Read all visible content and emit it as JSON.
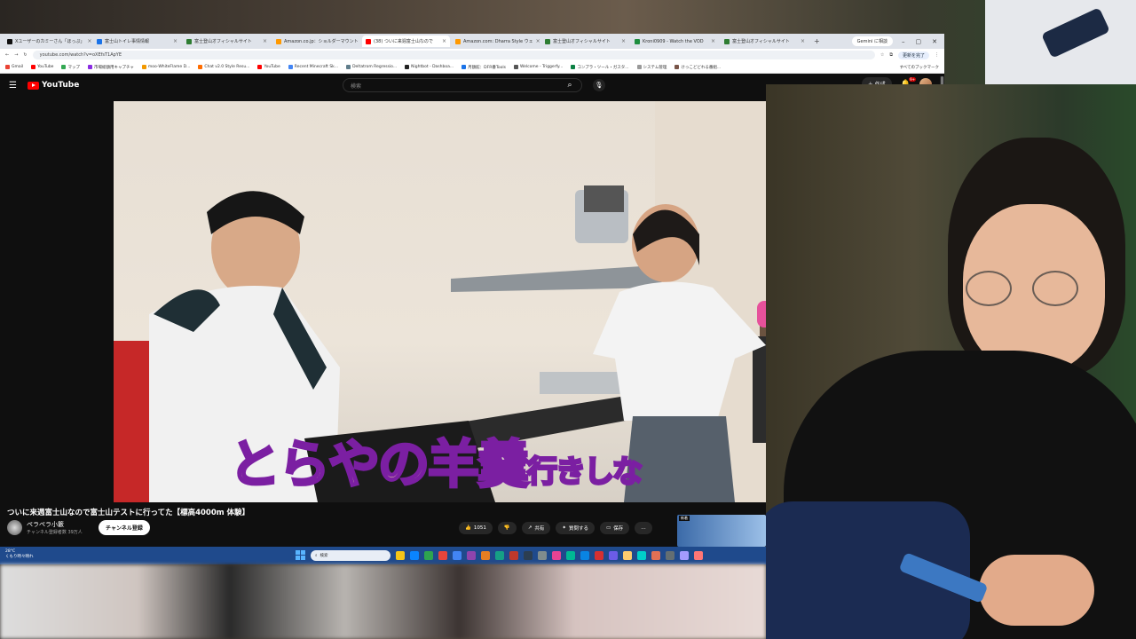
{
  "browser": {
    "tabs": [
      {
        "label": "Xユーザーのカミーさん「ほっぷ」",
        "color": "#111"
      },
      {
        "label": "富士山トイレ事情情報",
        "color": "#1a73e8"
      },
      {
        "label": "富士登山オフィシャルサイト",
        "color": "#2e7d32"
      },
      {
        "label": "Amazon.co.jp：ショルダーマウント",
        "color": "#ff9900"
      },
      {
        "label": "(38) ついに来週富士山なので",
        "color": "#ff0000",
        "active": true
      },
      {
        "label": "Amazon.com: Dharra Style ウェ",
        "color": "#ff9900"
      },
      {
        "label": "富士登山オフィシャルサイト",
        "color": "#2e7d32"
      },
      {
        "label": "Kroni0909 - Watch the VOD",
        "color": "#1e8e3e"
      },
      {
        "label": "富士登山オフィシャルサイト",
        "color": "#2e7d32"
      }
    ],
    "gemini_label": "Gemini に相談",
    "url": "youtube.com/watch?v=oXEfsT1ApYE",
    "update_label": "更新を完了",
    "bookmarks": [
      "Gmail",
      "YouTube",
      "マップ",
      "市場総額用キャプチャ",
      "moo-WhiteFlame D...",
      "Chat v2.0 Style Resu...",
      "YouTube",
      "Recent Minecraft Sk...",
      "Deltatrom Regressio...",
      "Nightbot - Dashboa...",
      "月額館：DFR番Tools",
      "Welcome - Triggerfy...",
      "コンプラ・ツール・ガスタ...",
      "システム管理",
      "けっこどどれる番組..."
    ],
    "bookmarks_right": "すべてのブックマーク"
  },
  "youtube": {
    "logo": "YouTube",
    "search_placeholder": "検索",
    "create_label": "作成",
    "bell_badge": "9+",
    "video_title": "ついに来週富士山なので富士山テストに行ってた【標高4000m 体験】",
    "channel_name": "ペラペラ小籔",
    "channel_subs": "チャンネル登録者数 39万人",
    "subscribe_label": "チャンネル登録",
    "likes": "1051",
    "share_label": "共有",
    "ask_label": "質問する",
    "save_label": "保存",
    "more_label": "…",
    "miniad_tag": "新着",
    "subtitle_big": "とらやの羊羹",
    "subtitle_small": "行きしな"
  },
  "taskbar": {
    "temp": "28°C",
    "weather": "くもり時々晴れ",
    "search_placeholder": "検索"
  }
}
